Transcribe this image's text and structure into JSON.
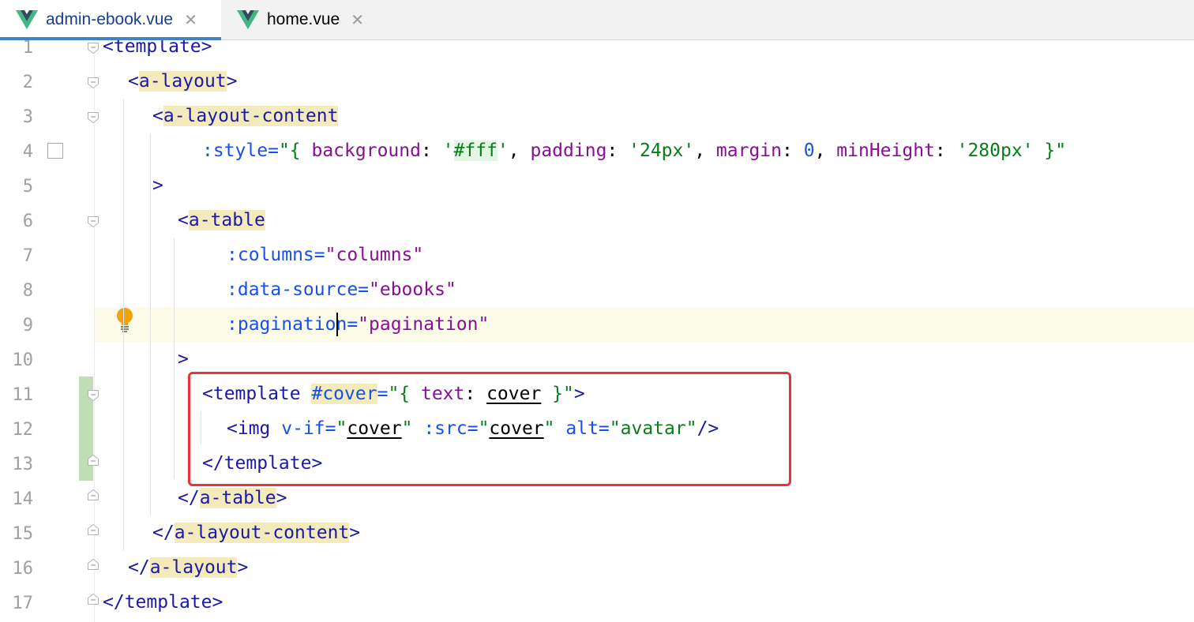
{
  "tabs": [
    {
      "label": "admin-ebook.vue",
      "close_icon": "close-icon",
      "active": true
    },
    {
      "label": "home.vue",
      "close_icon": "close-icon",
      "active": false
    }
  ],
  "colors": {
    "tag": "#1a1aa6",
    "attribute": "#1750eb",
    "key": "#871094",
    "string": "#067d17",
    "tag_match_highlight": "#f4ebbd",
    "current_line": "#fbfbe8",
    "vcs_added": "#c1ddb8",
    "annotation_box": "#e8323c",
    "vue_green": "#41b883",
    "vue_dark": "#35495e"
  },
  "editor": {
    "current_line": 9,
    "line_numbers": [
      "1",
      "2",
      "3",
      "4",
      "5",
      "6",
      "7",
      "8",
      "9",
      "10",
      "11",
      "12",
      "13",
      "14",
      "15",
      "16",
      "17"
    ],
    "code": {
      "l1": {
        "open": "<",
        "tag": "template",
        "close": ">"
      },
      "l2": {
        "open": "<",
        "tag": "a-layout",
        "close": ">"
      },
      "l3": {
        "open": "<",
        "tag": "a-layout-content"
      },
      "l4": {
        "attr": ":style=",
        "q1": "\"{ ",
        "k1": "background",
        "c1": ": ",
        "s1a": "'",
        "s1b": "#fff",
        "s1c": "'",
        "sep1": ", ",
        "k2": "padding",
        "c2": ": ",
        "s2": "'24px'",
        "sep2": ", ",
        "k3": "margin",
        "c3": ": ",
        "n3": "0",
        "sep3": ", ",
        "k4": "minHeight",
        "c4": ": ",
        "s4": "'280px'",
        "q2": " }\""
      },
      "l5": {
        "close": ">"
      },
      "l6": {
        "open": "<",
        "tag": "a-table"
      },
      "l7": {
        "attr": ":columns=",
        "val": "\"columns\""
      },
      "l8": {
        "attr": ":data-source=",
        "val": "\"ebooks\""
      },
      "l9": {
        "attr_a": ":paginati",
        "attr_b": "on=",
        "val": "\"pagination\""
      },
      "l10": {
        "close": ">"
      },
      "l11": {
        "open": "<template ",
        "slot": "#cover",
        "eq": "=",
        "q1": "\"{ ",
        "k": "text",
        "c": ": ",
        "v": "cover",
        "q2": " }\"",
        "close": ">"
      },
      "l12": {
        "open": "<img ",
        "a1": "v-if=",
        "q1": "\"",
        "v1": "cover",
        "q1e": "\"",
        "a2": " :src=",
        "q2": "\"",
        "v2": "cover",
        "q2e": "\"",
        "a3": " alt=",
        "v3": "\"avatar\"",
        "close": "/>"
      },
      "l13": {
        "tag": "</template>"
      },
      "l14": {
        "open": "</",
        "tag": "a-table",
        "close": ">"
      },
      "l15": {
        "open": "</",
        "tag": "a-layout-content",
        "close": ">"
      },
      "l16": {
        "open": "</",
        "tag": "a-layout",
        "close": ">"
      },
      "l17": {
        "open": "</",
        "tag": "template",
        "close": ">"
      }
    }
  },
  "icons": {
    "file_type": "vue-logo-icon",
    "intention": "lightbulb-icon",
    "fold": "fold-marker-icon"
  }
}
